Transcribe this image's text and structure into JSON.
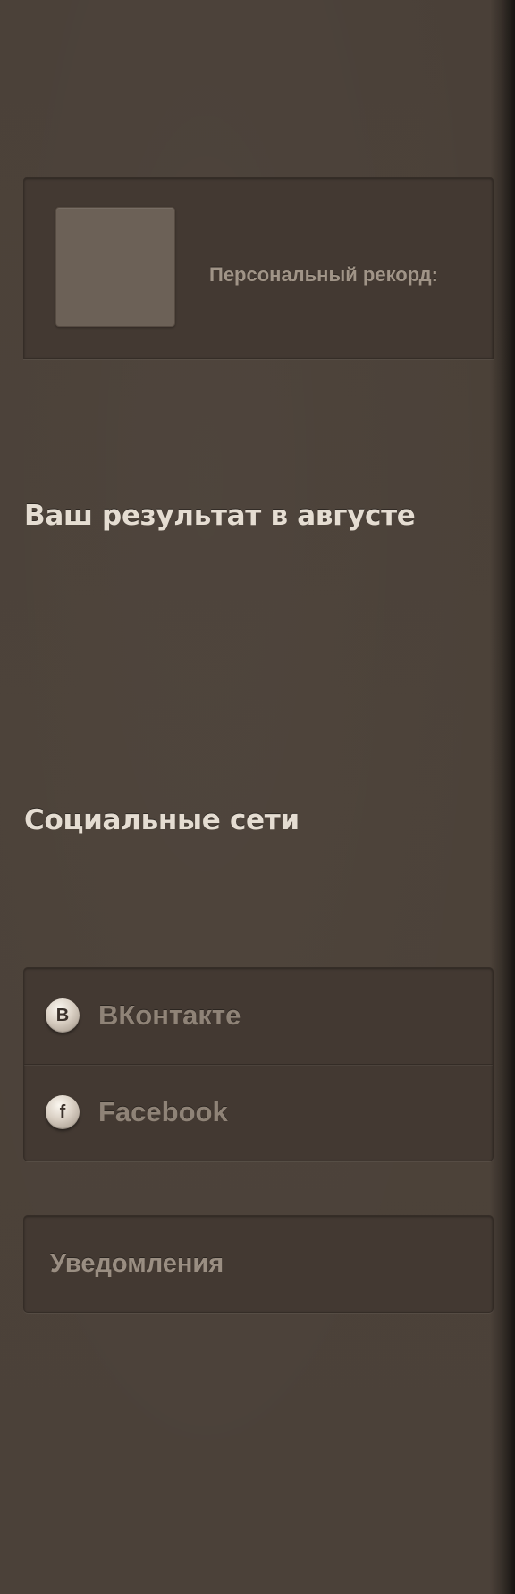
{
  "profile": {
    "record_label": "Персональный рекорд:"
  },
  "sections": {
    "result_title": "Ваш результат в августе",
    "social_title": "Социальные сети"
  },
  "social": {
    "items": [
      {
        "icon_letter": "B",
        "label": "ВКонтакте",
        "icon": "vk-icon"
      },
      {
        "icon_letter": "f",
        "label": "Facebook",
        "icon": "facebook-icon"
      }
    ]
  },
  "notifications": {
    "label": "Уведомления"
  },
  "colors": {
    "background": "#4b4139",
    "panel": "#433932",
    "title_text": "#e5ddd2",
    "muted_text": "#9a8e82",
    "avatar_placeholder": "#6c6157"
  }
}
